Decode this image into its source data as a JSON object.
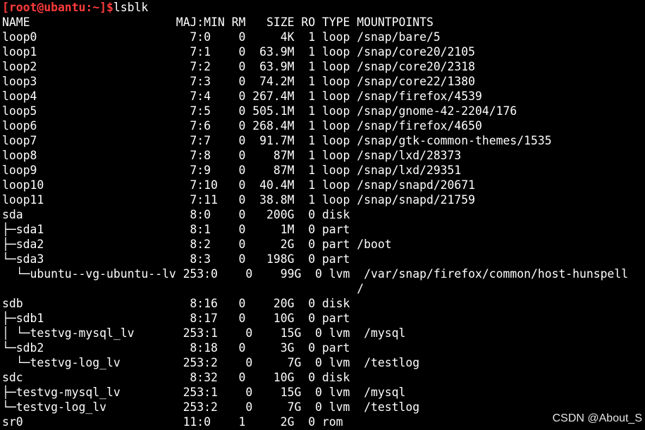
{
  "prompt": {
    "user_host": "[root@ubantu:~]",
    "symbol": "$",
    "command": "lsblk"
  },
  "colors": {
    "background": "#000000",
    "prompt": "#ff3b3b",
    "text": "#ffffff"
  },
  "output_lines": [
    "NAME                     MAJ:MIN RM   SIZE RO TYPE MOUNTPOINTS",
    "loop0                      7:0    0     4K  1 loop /snap/bare/5",
    "loop1                      7:1    0  63.9M  1 loop /snap/core20/2105",
    "loop2                      7:2    0  63.9M  1 loop /snap/core20/2318",
    "loop3                      7:3    0  74.2M  1 loop /snap/core22/1380",
    "loop4                      7:4    0 267.4M  1 loop /snap/firefox/4539",
    "loop5                      7:5    0 505.1M  1 loop /snap/gnome-42-2204/176",
    "loop6                      7:6    0 268.4M  1 loop /snap/firefox/4650",
    "loop7                      7:7    0  91.7M  1 loop /snap/gtk-common-themes/1535",
    "loop8                      7:8    0    87M  1 loop /snap/lxd/28373",
    "loop9                      7:9    0    87M  1 loop /snap/lxd/29351",
    "loop10                     7:10   0  40.4M  1 loop /snap/snapd/20671",
    "loop11                     7:11   0  38.8M  1 loop /snap/snapd/21759",
    "sda                        8:0    0   200G  0 disk ",
    "├─sda1                     8:1    0     1M  0 part ",
    "├─sda2                     8:2    0     2G  0 part /boot",
    "└─sda3                     8:3    0   198G  0 part ",
    "  └─ubuntu--vg-ubuntu--lv 253:0    0    99G  0 lvm  /var/snap/firefox/common/host-hunspell",
    "                                                   /",
    "sdb                        8:16   0    20G  0 disk ",
    "├─sdb1                     8:17   0    10G  0 part ",
    "│ └─testvg-mysql_lv       253:1    0    15G  0 lvm  /mysql",
    "└─sdb2                     8:18   0     3G  0 part ",
    "  └─testvg-log_lv         253:2    0     7G  0 lvm  /testlog",
    "sdc                        8:32   0    10G  0 disk ",
    "├─testvg-mysql_lv         253:1    0    15G  0 lvm  /mysql",
    "└─testvg-log_lv           253:2    0     7G  0 lvm  /testlog",
    "sr0                       11:0    1     2G  0 rom  "
  ],
  "watermark": "CSDN @About_S"
}
